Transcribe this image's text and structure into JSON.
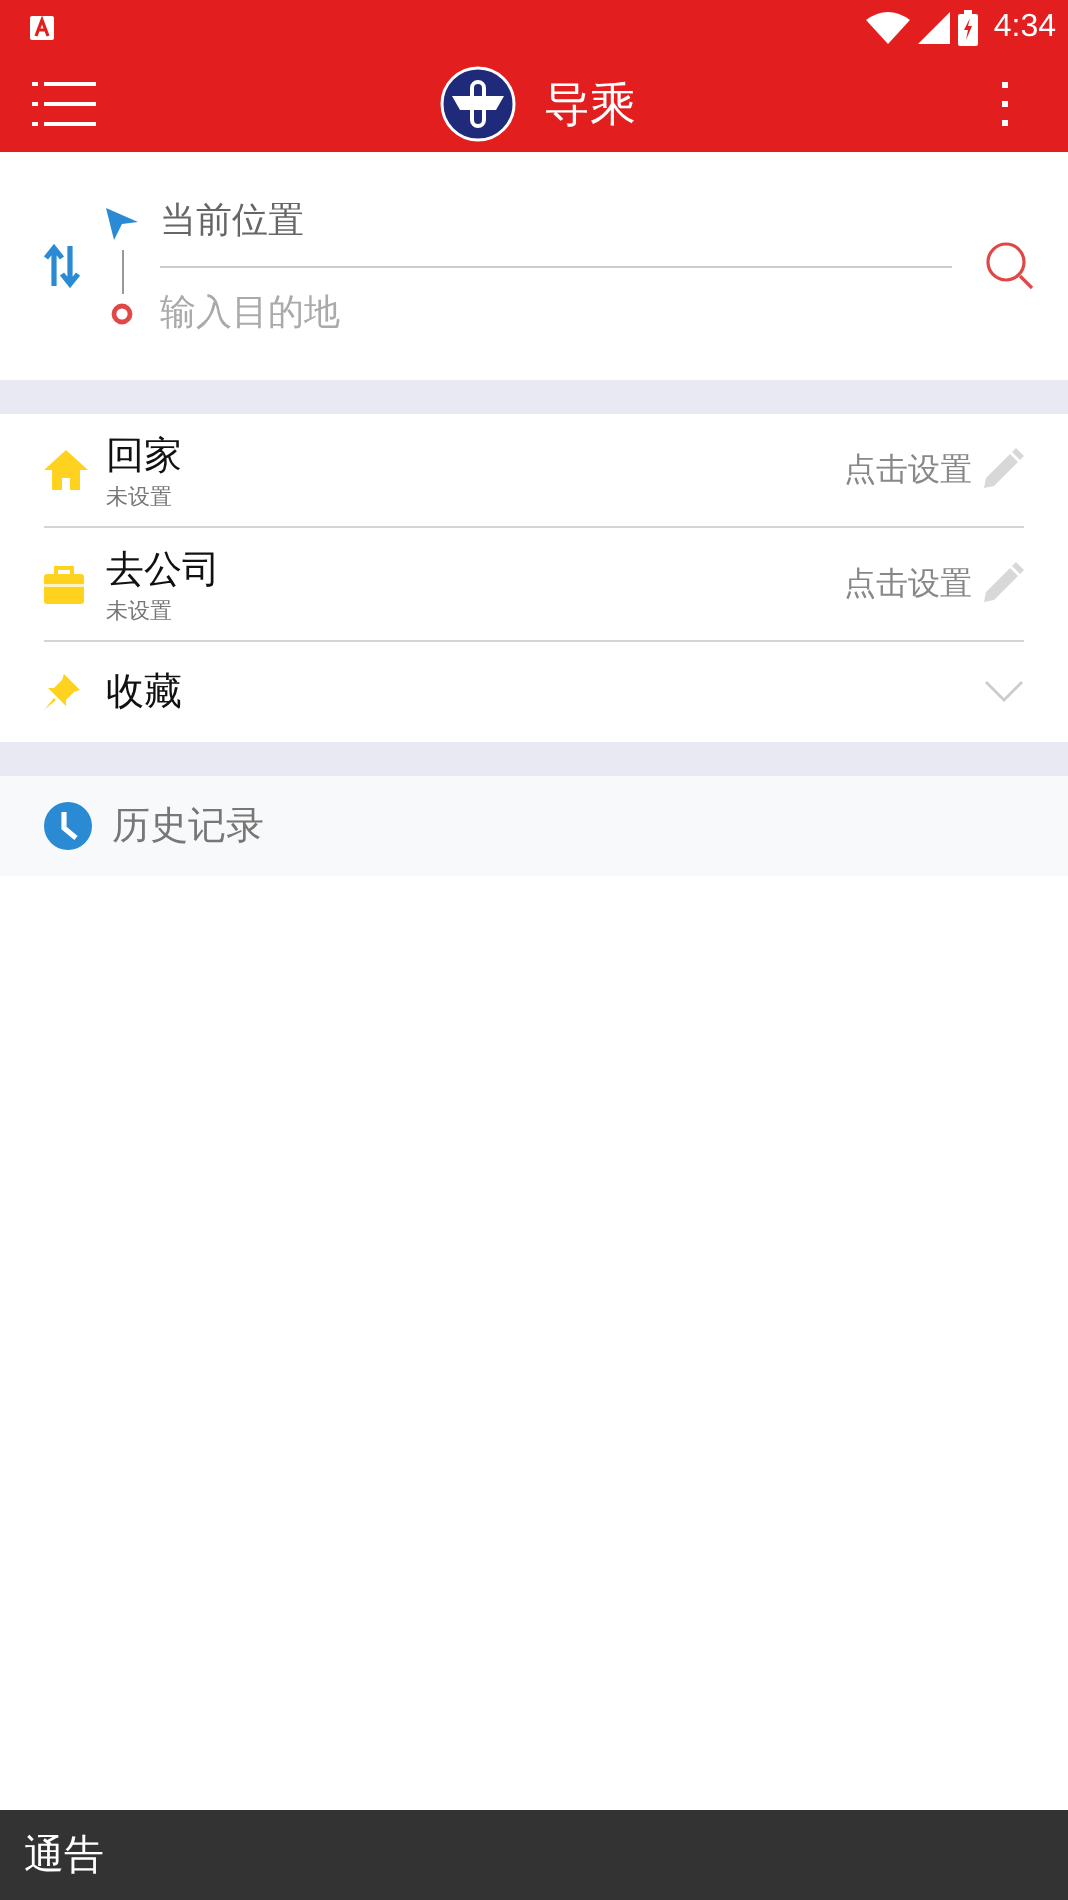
{
  "status_bar": {
    "time": "4:34"
  },
  "app_bar": {
    "title": "导乘"
  },
  "route": {
    "origin": {
      "value": "当前位置"
    },
    "destination": {
      "placeholder": "输入目的地"
    }
  },
  "places": [
    {
      "kind": "home",
      "title": "回家",
      "subtitle": "未设置",
      "action": "点击设置"
    },
    {
      "kind": "work",
      "title": "去公司",
      "subtitle": "未设置",
      "action": "点击设置"
    },
    {
      "kind": "favorites",
      "title": "收藏",
      "expanded": false
    }
  ],
  "history": {
    "title": "历史记录"
  },
  "notice_bar": {
    "title": "通告"
  }
}
